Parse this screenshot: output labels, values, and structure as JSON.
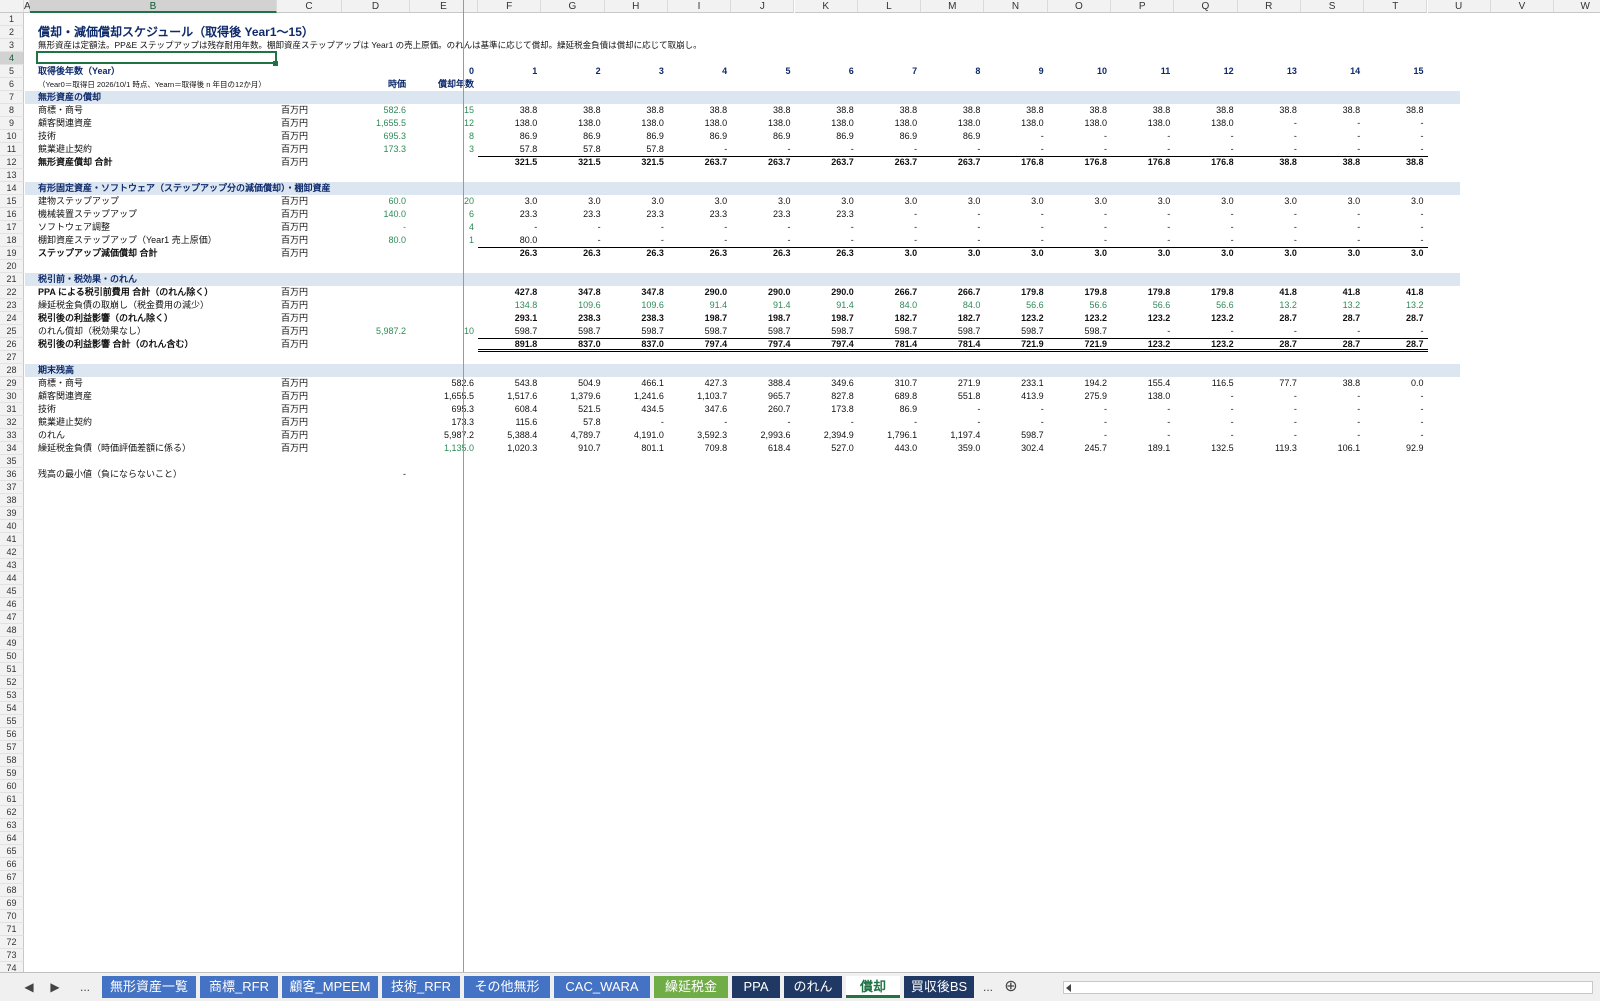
{
  "columns": [
    "A",
    "B",
    "C",
    "D",
    "E",
    "F",
    "G",
    "H",
    "I",
    "J",
    "K",
    "L",
    "M",
    "N",
    "O",
    "P",
    "Q",
    "R",
    "S",
    "T",
    "U",
    "V",
    "W"
  ],
  "selected_column": "B",
  "row_count": 74,
  "title": "償却・減価償却スケジュール（取得後 Year1～15）",
  "subtitle": "無形資産は定額法。PP&E ステップアップは残存耐用年数。棚卸資産ステップアップは Year1 の売上原価。のれんは基準に応じて償却。繰延税金負債は償却に応じて取崩し。",
  "header_row": {
    "label": "取得後年数（Year）",
    "year0": "0",
    "years": [
      "1",
      "2",
      "3",
      "4",
      "5",
      "6",
      "7",
      "8",
      "9",
      "10",
      "11",
      "12",
      "13",
      "14",
      "15"
    ]
  },
  "note_row": {
    "label": "（Year0＝取得日 2026/10/1 時点、Yearn＝取得後 n 年目の12か月）",
    "col_d": "時価",
    "col_e": "償却年数"
  },
  "sections": {
    "s7": "無形資産の償却",
    "s14": "有形固定資産・ソフトウェア（ステップアップ分の減価償却）・棚卸資産",
    "s21": "税引前・税効果・のれん",
    "s28": "期末残高"
  },
  "rows": [
    {
      "row": 8,
      "label": "商標・商号",
      "unit": "百万円",
      "d": "582.6",
      "e": "15",
      "vals": [
        "38.8",
        "38.8",
        "38.8",
        "38.8",
        "38.8",
        "38.8",
        "38.8",
        "38.8",
        "38.8",
        "38.8",
        "38.8",
        "38.8",
        "38.8",
        "38.8",
        "38.8"
      ]
    },
    {
      "row": 9,
      "label": "顧客関連資産",
      "unit": "百万円",
      "d": "1,655.5",
      "e": "12",
      "vals": [
        "138.0",
        "138.0",
        "138.0",
        "138.0",
        "138.0",
        "138.0",
        "138.0",
        "138.0",
        "138.0",
        "138.0",
        "138.0",
        "138.0",
        "-",
        "-",
        "-"
      ]
    },
    {
      "row": 10,
      "label": "技術",
      "unit": "百万円",
      "d": "695.3",
      "e": "8",
      "vals": [
        "86.9",
        "86.9",
        "86.9",
        "86.9",
        "86.9",
        "86.9",
        "86.9",
        "86.9",
        "-",
        "-",
        "-",
        "-",
        "-",
        "-",
        "-"
      ]
    },
    {
      "row": 11,
      "label": "競業避止契約",
      "unit": "百万円",
      "d": "173.3",
      "e": "3",
      "vals": [
        "57.8",
        "57.8",
        "57.8",
        "-",
        "-",
        "-",
        "-",
        "-",
        "-",
        "-",
        "-",
        "-",
        "-",
        "-",
        "-"
      ]
    },
    {
      "row": 12,
      "label": "無形資産償却 合計",
      "unit": "百万円",
      "bold": true,
      "vals": [
        "321.5",
        "321.5",
        "321.5",
        "263.7",
        "263.7",
        "263.7",
        "263.7",
        "263.7",
        "176.8",
        "176.8",
        "176.8",
        "176.8",
        "38.8",
        "38.8",
        "38.8"
      ]
    },
    {
      "row": 15,
      "label": "建物ステップアップ",
      "unit": "百万円",
      "d": "60.0",
      "e": "20",
      "vals": [
        "3.0",
        "3.0",
        "3.0",
        "3.0",
        "3.0",
        "3.0",
        "3.0",
        "3.0",
        "3.0",
        "3.0",
        "3.0",
        "3.0",
        "3.0",
        "3.0",
        "3.0"
      ]
    },
    {
      "row": 16,
      "label": "機械装置ステップアップ",
      "unit": "百万円",
      "d": "140.0",
      "e": "6",
      "vals": [
        "23.3",
        "23.3",
        "23.3",
        "23.3",
        "23.3",
        "23.3",
        "-",
        "-",
        "-",
        "-",
        "-",
        "-",
        "-",
        "-",
        "-"
      ]
    },
    {
      "row": 17,
      "label": "ソフトウェア調整",
      "unit": "百万円",
      "d": "-",
      "e": "4",
      "vals": [
        "-",
        "-",
        "-",
        "-",
        "-",
        "-",
        "-",
        "-",
        "-",
        "-",
        "-",
        "-",
        "-",
        "-",
        "-"
      ]
    },
    {
      "row": 18,
      "label": "棚卸資産ステップアップ（Year1 売上原価）",
      "unit": "百万円",
      "d": "80.0",
      "e": "1",
      "vals": [
        "80.0",
        "-",
        "-",
        "-",
        "-",
        "-",
        "-",
        "-",
        "-",
        "-",
        "-",
        "-",
        "-",
        "-",
        "-"
      ]
    },
    {
      "row": 19,
      "label": "ステップアップ減価償却 合計",
      "unit": "百万円",
      "bold": true,
      "vals": [
        "26.3",
        "26.3",
        "26.3",
        "26.3",
        "26.3",
        "26.3",
        "3.0",
        "3.0",
        "3.0",
        "3.0",
        "3.0",
        "3.0",
        "3.0",
        "3.0",
        "3.0"
      ]
    },
    {
      "row": 22,
      "label": "PPA による税引前費用 合計（のれん除く）",
      "unit": "百万円",
      "bold": true,
      "vals": [
        "427.8",
        "347.8",
        "347.8",
        "290.0",
        "290.0",
        "290.0",
        "266.7",
        "266.7",
        "179.8",
        "179.8",
        "179.8",
        "179.8",
        "41.8",
        "41.8",
        "41.8"
      ]
    },
    {
      "row": 23,
      "label": "繰延税金負債の取崩し（税金費用の減少）",
      "unit": "百万円",
      "green": true,
      "vals": [
        "134.8",
        "109.6",
        "109.6",
        "91.4",
        "91.4",
        "91.4",
        "84.0",
        "84.0",
        "56.6",
        "56.6",
        "56.6",
        "56.6",
        "13.2",
        "13.2",
        "13.2"
      ]
    },
    {
      "row": 24,
      "label": "税引後の利益影響（のれん除く）",
      "unit": "百万円",
      "bold": true,
      "vals": [
        "293.1",
        "238.3",
        "238.3",
        "198.7",
        "198.7",
        "198.7",
        "182.7",
        "182.7",
        "123.2",
        "123.2",
        "123.2",
        "123.2",
        "28.7",
        "28.7",
        "28.7"
      ]
    },
    {
      "row": 25,
      "label": "のれん償却（税効果なし）",
      "unit": "百万円",
      "d": "5,987.2",
      "e": "10",
      "vals": [
        "598.7",
        "598.7",
        "598.7",
        "598.7",
        "598.7",
        "598.7",
        "598.7",
        "598.7",
        "598.7",
        "598.7",
        "-",
        "-",
        "-",
        "-",
        "-"
      ]
    },
    {
      "row": 26,
      "label": "税引後の利益影響 合計（のれん含む）",
      "unit": "百万円",
      "bold": true,
      "vals": [
        "891.8",
        "837.0",
        "837.0",
        "797.4",
        "797.4",
        "797.4",
        "781.4",
        "781.4",
        "721.9",
        "721.9",
        "123.2",
        "123.2",
        "28.7",
        "28.7",
        "28.7"
      ]
    },
    {
      "row": 29,
      "label": "商標・商号",
      "unit": "百万円",
      "e": "582.6",
      "vals": [
        "543.8",
        "504.9",
        "466.1",
        "427.3",
        "388.4",
        "349.6",
        "310.7",
        "271.9",
        "233.1",
        "194.2",
        "155.4",
        "116.5",
        "77.7",
        "38.8",
        "0.0"
      ]
    },
    {
      "row": 30,
      "label": "顧客関連資産",
      "unit": "百万円",
      "e": "1,655.5",
      "vals": [
        "1,517.6",
        "1,379.6",
        "1,241.6",
        "1,103.7",
        "965.7",
        "827.8",
        "689.8",
        "551.8",
        "413.9",
        "275.9",
        "138.0",
        "-",
        "-",
        "-",
        "-"
      ]
    },
    {
      "row": 31,
      "label": "技術",
      "unit": "百万円",
      "e": "695.3",
      "vals": [
        "608.4",
        "521.5",
        "434.5",
        "347.6",
        "260.7",
        "173.8",
        "86.9",
        "-",
        "-",
        "-",
        "-",
        "-",
        "-",
        "-",
        "-"
      ]
    },
    {
      "row": 32,
      "label": "競業避止契約",
      "unit": "百万円",
      "e": "173.3",
      "vals": [
        "115.6",
        "57.8",
        "-",
        "-",
        "-",
        "-",
        "-",
        "-",
        "-",
        "-",
        "-",
        "-",
        "-",
        "-",
        "-"
      ]
    },
    {
      "row": 33,
      "label": "のれん",
      "unit": "百万円",
      "e": "5,987.2",
      "vals": [
        "5,388.4",
        "4,789.7",
        "4,191.0",
        "3,592.3",
        "2,993.6",
        "2,394.9",
        "1,796.1",
        "1,197.4",
        "598.7",
        "-",
        "-",
        "-",
        "-",
        "-",
        "-"
      ]
    },
    {
      "row": 34,
      "label": "繰延税金負債（時価評価差額に係る）",
      "unit": "百万円",
      "e": "1,135.0",
      "egreen": true,
      "vals": [
        "1,020.3",
        "910.7",
        "801.1",
        "709.8",
        "618.4",
        "527.0",
        "443.0",
        "359.0",
        "302.4",
        "245.7",
        "189.1",
        "132.5",
        "119.3",
        "106.1",
        "92.9"
      ]
    }
  ],
  "row36": {
    "label": "残高の最小値（負にならないこと）",
    "value": "-"
  },
  "tabs": [
    {
      "label": "無形資産一覧",
      "color": "#4472c4"
    },
    {
      "label": "商標_RFR",
      "color": "#4472c4"
    },
    {
      "label": "顧客_MPEEM",
      "color": "#4472c4"
    },
    {
      "label": "技術_RFR",
      "color": "#4472c4"
    },
    {
      "label": "その他無形",
      "color": "#4472c4"
    },
    {
      "label": "CAC_WARA",
      "color": "#4472c4"
    },
    {
      "label": "繰延税金",
      "color": "#70ad47"
    },
    {
      "label": "PPA",
      "color": "#1f3864"
    },
    {
      "label": "のれん",
      "color": "#1f3864"
    },
    {
      "label": "償却",
      "color": "#ffffff",
      "active": true
    },
    {
      "label": "買収後BS",
      "color": "#1f3864"
    }
  ],
  "tab_nav": {
    "prev": "◀",
    "next": "▶",
    "more_left": "...",
    "more_right": "...",
    "add": "⊕"
  }
}
